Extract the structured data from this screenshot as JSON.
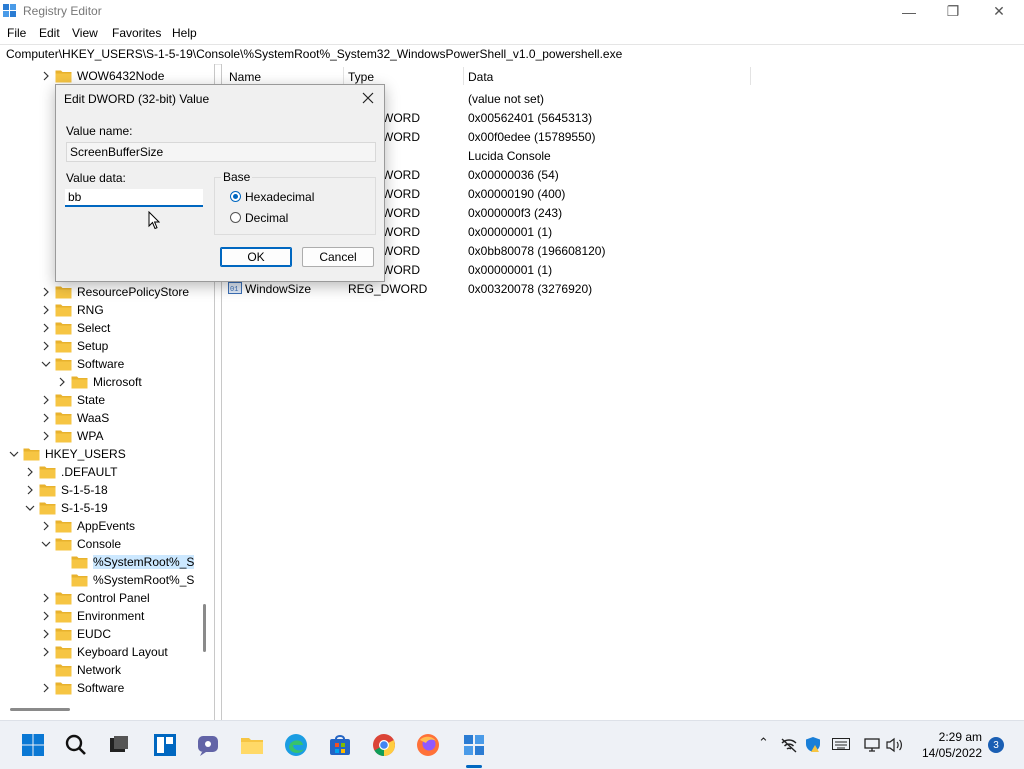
{
  "window": {
    "title": "Registry Editor",
    "min": "—",
    "max": "❐",
    "close": "✕"
  },
  "menu": [
    "File",
    "Edit",
    "View",
    "Favorites",
    "Help"
  ],
  "address": "Computer\\HKEY_USERS\\S-1-5-19\\Console\\%SystemRoot%_System32_WindowsPowerShell_v1.0_powershell.exe",
  "tree": [
    {
      "label": "WOW6432Node",
      "indent": 3,
      "chev": "right",
      "selected": false
    },
    {
      "label": "ResourcePolicyStore",
      "indent": 3,
      "chev": "right",
      "selected": false
    },
    {
      "label": "RNG",
      "indent": 3,
      "chev": "right",
      "selected": false
    },
    {
      "label": "Select",
      "indent": 3,
      "chev": "right",
      "selected": false
    },
    {
      "label": "Setup",
      "indent": 3,
      "chev": "right",
      "selected": false
    },
    {
      "label": "Software",
      "indent": 3,
      "chev": "down",
      "selected": false
    },
    {
      "label": "Microsoft",
      "indent": 4,
      "chev": "right",
      "selected": false
    },
    {
      "label": "State",
      "indent": 3,
      "chev": "right",
      "selected": false
    },
    {
      "label": "WaaS",
      "indent": 3,
      "chev": "right",
      "selected": false
    },
    {
      "label": "WPA",
      "indent": 3,
      "chev": "right",
      "selected": false
    },
    {
      "label": "HKEY_USERS",
      "indent": 1,
      "chev": "down",
      "selected": false
    },
    {
      "label": ".DEFAULT",
      "indent": 2,
      "chev": "right",
      "selected": false
    },
    {
      "label": "S-1-5-18",
      "indent": 2,
      "chev": "right",
      "selected": false
    },
    {
      "label": "S-1-5-19",
      "indent": 2,
      "chev": "down",
      "selected": false
    },
    {
      "label": "AppEvents",
      "indent": 3,
      "chev": "right",
      "selected": false
    },
    {
      "label": "Console",
      "indent": 3,
      "chev": "down",
      "selected": false
    },
    {
      "label": "%SystemRoot%_S",
      "indent": 4,
      "chev": "none",
      "selected": true
    },
    {
      "label": "%SystemRoot%_S",
      "indent": 4,
      "chev": "none",
      "selected": false
    },
    {
      "label": "Control Panel",
      "indent": 3,
      "chev": "right",
      "selected": false
    },
    {
      "label": "Environment",
      "indent": 3,
      "chev": "right",
      "selected": false
    },
    {
      "label": "EUDC",
      "indent": 3,
      "chev": "right",
      "selected": false
    },
    {
      "label": "Keyboard Layout",
      "indent": 3,
      "chev": "right",
      "selected": false
    },
    {
      "label": "Network",
      "indent": 3,
      "chev": "none",
      "selected": false
    },
    {
      "label": "Software",
      "indent": 3,
      "chev": "right",
      "selected": false
    }
  ],
  "columns": [
    "Name",
    "Type",
    "Data"
  ],
  "rows": [
    {
      "name": "",
      "type": "",
      "data": "(value not set)"
    },
    {
      "name": "",
      "type": "WORD",
      "data": "0x00562401 (5645313)"
    },
    {
      "name": "",
      "type": "WORD",
      "data": "0x00f0edee (15789550)"
    },
    {
      "name": "",
      "type": "",
      "data": "Lucida Console"
    },
    {
      "name": "",
      "type": "WORD",
      "data": "0x00000036 (54)"
    },
    {
      "name": "",
      "type": "WORD",
      "data": "0x00000190 (400)"
    },
    {
      "name": "",
      "type": "WORD",
      "data": "0x000000f3 (243)"
    },
    {
      "name": "",
      "type": "WORD",
      "data": "0x00000001 (1)"
    },
    {
      "name": "",
      "type": "WORD",
      "data": "0x0bb80078 (196608120)"
    },
    {
      "name": "",
      "type": "WORD",
      "data": "0x00000001 (1)"
    },
    {
      "name": "WindowSize",
      "type": "REG_DWORD",
      "data": "0x00320078 (3276920)"
    }
  ],
  "dialog": {
    "title": "Edit DWORD (32-bit) Value",
    "value_name_label": "Value name:",
    "value_name": "ScreenBufferSize",
    "value_data_label": "Value data:",
    "value_data": "bb",
    "base_label": "Base",
    "hex_label": "Hexadecimal",
    "dec_label": "Decimal",
    "ok": "OK",
    "cancel": "Cancel"
  },
  "taskbar": {
    "icons": [
      "windows-start-icon",
      "search-icon",
      "task-view-icon",
      "widgets-icon",
      "chat-icon",
      "file-explorer-icon",
      "edge-icon",
      "store-icon",
      "chrome-icon",
      "firefox-icon",
      "registry-editor-icon"
    ],
    "time": "2:29 am",
    "date": "14/05/2022",
    "notifications": "3"
  },
  "colors": {
    "accent": "#0067c0",
    "folder": "#f6c543",
    "selection": "#cce8ff"
  }
}
